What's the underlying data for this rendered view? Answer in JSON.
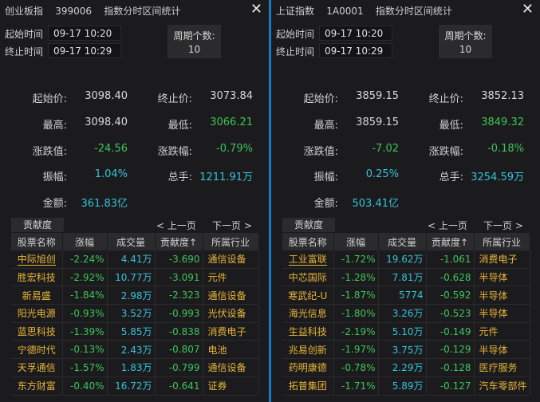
{
  "panels": [
    {
      "title": "创业板指    399006    指数分时区间统计",
      "close": "✕",
      "start_label": "起始时间",
      "start_value": "09-17 10:20",
      "end_label": "终止时间",
      "end_value": "09-17 10:29",
      "period_label": "周期个数:",
      "period_value": "10",
      "stats": {
        "start_price_label": "起始价:",
        "start_price": "3098.40",
        "end_price_label": "终止价:",
        "end_price": "3073.84",
        "high_label": "最高:",
        "high": "3098.40",
        "low_label": "最低:",
        "low": "3066.21",
        "change_label": "涨跌值:",
        "change": "-24.56",
        "pct_label": "涨跌幅:",
        "pct": "-0.79%",
        "amp_label": "振幅:",
        "amp": "1.04%",
        "vol_label": "总手:",
        "vol": "1211.91万",
        "amount_label": "金额:",
        "amount": "361.83亿"
      },
      "contrib_label": "贡献度",
      "prev_page": "< 上一页",
      "next_page": "下一页 >",
      "headers": [
        "股票名称",
        "涨幅",
        "成交量",
        "贡献度↑",
        "所属行业"
      ],
      "rows": [
        {
          "name": "中际旭创",
          "chg": "-2.24%",
          "vol": "4.41万",
          "contrib": "-3.690",
          "industry": "通信设备"
        },
        {
          "name": "胜宏科技",
          "chg": "-2.92%",
          "vol": "10.77万",
          "contrib": "-3.091",
          "industry": "元件"
        },
        {
          "name": "新易盛",
          "chg": "-1.84%",
          "vol": "2.98万",
          "contrib": "-2.323",
          "industry": "通信设备"
        },
        {
          "name": "阳光电源",
          "chg": "-0.93%",
          "vol": "3.52万",
          "contrib": "-0.993",
          "industry": "光伏设备"
        },
        {
          "name": "蓝思科技",
          "chg": "-1.39%",
          "vol": "5.85万",
          "contrib": "-0.838",
          "industry": "消费电子"
        },
        {
          "name": "宁德时代",
          "chg": "-0.13%",
          "vol": "2.43万",
          "contrib": "-0.807",
          "industry": "电池"
        },
        {
          "name": "天孚通信",
          "chg": "-1.57%",
          "vol": "1.83万",
          "contrib": "-0.799",
          "industry": "通信设备"
        },
        {
          "name": "东方财富",
          "chg": "-0.40%",
          "vol": "16.72万",
          "contrib": "-0.641",
          "industry": "证券"
        }
      ]
    },
    {
      "title": "上证指数    1A0001    指数分时区间统计",
      "close": "✕",
      "start_label": "起始时间",
      "start_value": "09-17 10:20",
      "end_label": "终止时间",
      "end_value": "09-17 10:29",
      "period_label": "周期个数:",
      "period_value": "10",
      "stats": {
        "start_price_label": "起始价:",
        "start_price": "3859.15",
        "end_price_label": "终止价:",
        "end_price": "3852.13",
        "high_label": "最高:",
        "high": "3859.15",
        "low_label": "最低:",
        "low": "3849.32",
        "change_label": "涨跌值:",
        "change": "-7.02",
        "pct_label": "涨跌幅:",
        "pct": "-0.18%",
        "amp_label": "振幅:",
        "amp": "0.25%",
        "vol_label": "总手:",
        "vol": "3254.59万",
        "amount_label": "金额:",
        "amount": "503.41亿"
      },
      "contrib_label": "贡献度",
      "prev_page": "< 上一页",
      "next_page": "下一页 >",
      "headers": [
        "股票名称",
        "涨幅",
        "成交量",
        "贡献度↑",
        "所属行业"
      ],
      "rows": [
        {
          "name": "工业富联",
          "chg": "-1.72%",
          "vol": "19.62万",
          "contrib": "-1.061",
          "industry": "消费电子"
        },
        {
          "name": "中芯国际",
          "chg": "-1.28%",
          "vol": "7.81万",
          "contrib": "-0.628",
          "industry": "半导体"
        },
        {
          "name": "寒武纪-U",
          "chg": "-1.87%",
          "vol": "5774",
          "contrib": "-0.592",
          "industry": "半导体"
        },
        {
          "name": "海光信息",
          "chg": "-1.80%",
          "vol": "3.26万",
          "contrib": "-0.523",
          "industry": "半导体"
        },
        {
          "name": "生益科技",
          "chg": "-2.19%",
          "vol": "5.10万",
          "contrib": "-0.149",
          "industry": "元件"
        },
        {
          "name": "兆易创新",
          "chg": "-1.97%",
          "vol": "3.75万",
          "contrib": "-0.129",
          "industry": "半导体"
        },
        {
          "name": "药明康德",
          "chg": "-0.78%",
          "vol": "2.29万",
          "contrib": "-0.128",
          "industry": "医疗服务"
        },
        {
          "name": "拓普集团",
          "chg": "-1.71%",
          "vol": "5.89万",
          "contrib": "-0.127",
          "industry": "汽车零部件"
        }
      ]
    }
  ],
  "colors": {
    "up_down_green": "#3ec45a",
    "cyan": "#36c2d8",
    "gold": "#e8b53a",
    "divider": "#1e78c8"
  }
}
